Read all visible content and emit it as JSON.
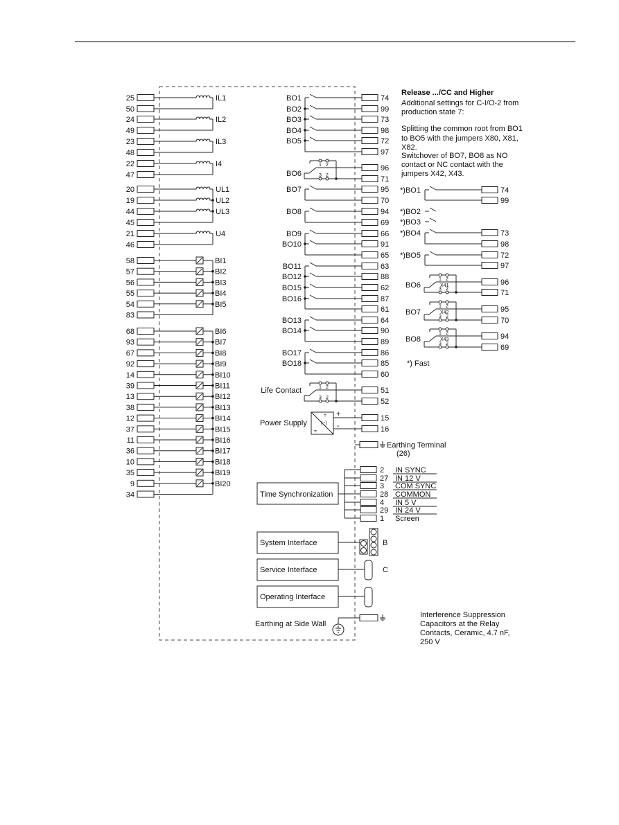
{
  "left": {
    "coil_pairs_top": [
      {
        "label": "IL1",
        "terminals": [
          "25",
          "50"
        ]
      },
      {
        "label": "IL2",
        "terminals": [
          "24",
          "49"
        ]
      },
      {
        "label": "IL3",
        "terminals": [
          "23",
          "48"
        ]
      },
      {
        "label": "I4",
        "terminals": [
          "22",
          "47"
        ]
      }
    ],
    "voltage_group": {
      "labels": [
        "UL1",
        "UL2",
        "UL3"
      ],
      "terminals": [
        "20",
        "19",
        "44"
      ],
      "common": "45"
    },
    "coil_pair_u4": {
      "label": "U4",
      "terminals": [
        "21",
        "46"
      ]
    },
    "binary_groups": [
      {
        "labels": [
          "BI1",
          "BI2",
          "BI3",
          "BI4",
          "BI5"
        ],
        "terminals": [
          "58",
          "57",
          "56",
          "55",
          "54"
        ],
        "common": "83"
      },
      {
        "labels": [
          "BI6",
          "BI7",
          "BI8",
          "BI9",
          "BI10",
          "BI11",
          "BI12",
          "BI13",
          "BI14",
          "BI15",
          "BI16",
          "BI17",
          "BI18",
          "BI19",
          "BI20"
        ],
        "terminals": [
          "68",
          "93",
          "67",
          "92",
          "14",
          "39",
          "13",
          "38",
          "12",
          "37",
          "11",
          "36",
          "10",
          "35",
          "9"
        ],
        "common": "34"
      }
    ]
  },
  "right": {
    "relay_groups": [
      {
        "contacts": [
          {
            "label": "BO1",
            "terminal": "74"
          },
          {
            "label": "BO2",
            "terminal": "99"
          },
          {
            "label": "BO3",
            "terminal": "73"
          },
          {
            "label": "BO4",
            "terminal": "98"
          },
          {
            "label": "BO5",
            "terminal": "72"
          }
        ],
        "common": "97"
      },
      {
        "contacts": [
          {
            "label": "BO7",
            "terminal": "95"
          }
        ],
        "common": "70"
      },
      {
        "contacts": [
          {
            "label": "BO8",
            "terminal": "94"
          }
        ],
        "common": "69"
      },
      {
        "contacts": [
          {
            "label": "BO9",
            "terminal": "66"
          },
          {
            "label": "BO10",
            "terminal": "91"
          }
        ],
        "common": "65"
      },
      {
        "contacts": [
          {
            "label": "BO11",
            "terminal": "63"
          },
          {
            "label": "BO12",
            "terminal": "88"
          },
          {
            "label": "BO15",
            "terminal": "62"
          },
          {
            "label": "BO16",
            "terminal": "87"
          }
        ],
        "common": "61"
      },
      {
        "contacts": [
          {
            "label": "BO13",
            "terminal": "64"
          },
          {
            "label": "BO14",
            "terminal": "90"
          }
        ],
        "common": "89"
      },
      {
        "contacts": [
          {
            "label": "BO17",
            "terminal": "86"
          },
          {
            "label": "BO18",
            "terminal": "85"
          }
        ],
        "common": "60"
      }
    ],
    "bo6": {
      "label": "BO6",
      "terminals": [
        "96",
        "71"
      ]
    },
    "life_contact": {
      "label": "Life Contact",
      "terminals": [
        "51",
        "52"
      ]
    },
    "pin_labels": [
      "1",
      "2",
      "3",
      "2"
    ],
    "power_supply": {
      "label": "Power Supply",
      "terminals": [
        "15",
        "16"
      ],
      "plus": "+",
      "minus": "-",
      "dc_symbol": "=",
      "ac_symbol": "(~)"
    },
    "earthing_terminal": {
      "label": "Earthing Terminal",
      "number": "(26)"
    },
    "time_sync": {
      "label": "Time Synchronization",
      "rows": [
        {
          "terminal": "2",
          "signal": "IN SYNC"
        },
        {
          "terminal": "27",
          "signal": "IN 12 V"
        },
        {
          "terminal": "3",
          "signal": "COM SYNC"
        },
        {
          "terminal": "28",
          "signal": "COMMON"
        },
        {
          "terminal": "4",
          "signal": "IN 5 V"
        },
        {
          "terminal": "29",
          "signal": "IN 24 V"
        },
        {
          "terminal": "1",
          "signal": "Screen"
        }
      ]
    },
    "interfaces": [
      {
        "label": "System Interface",
        "port": "B"
      },
      {
        "label": "Service Interface",
        "port": "C"
      },
      {
        "label": "Operating Interface",
        "port": ""
      }
    ],
    "side_wall_earthing": "Earthing at Side Wall"
  },
  "notes": {
    "title": "Release .../CC and Higher",
    "lines": [
      "Additional settings for C-I/O-2 from",
      "production state 7:",
      "",
      "Splitting the common root from BO1",
      "to BO5 with the jumpers X80, X81,",
      "X82.",
      "Switchover of BO7, BO8 as NO",
      "contact or NC contact with the",
      "jumpers X42, X43."
    ],
    "annex_contacts": [
      {
        "label": "*)BO1",
        "terminals": [
          "74",
          "99"
        ]
      },
      {
        "label": "*)BO2",
        "terminals": []
      },
      {
        "label": "*)BO3",
        "terminals": []
      },
      {
        "label": "*)BO4",
        "terminals": [
          "73",
          "98"
        ]
      },
      {
        "label": "*)BO5",
        "terminals": [
          "72",
          "97"
        ]
      }
    ],
    "annex_changeovers": [
      {
        "label": "BO6",
        "jumper": "X41",
        "terminals": [
          "96",
          "71"
        ]
      },
      {
        "label": "BO7",
        "jumper": "X42",
        "terminals": [
          "95",
          "70"
        ]
      },
      {
        "label": "BO8",
        "jumper": "X43",
        "terminals": [
          "94",
          "69"
        ]
      }
    ],
    "fast_note": "*) Fast",
    "interference": [
      "Interference Suppression",
      "Capacitors at the Relay",
      "Contacts, Ceramic, 4.7 nF,",
      "250 V"
    ]
  }
}
